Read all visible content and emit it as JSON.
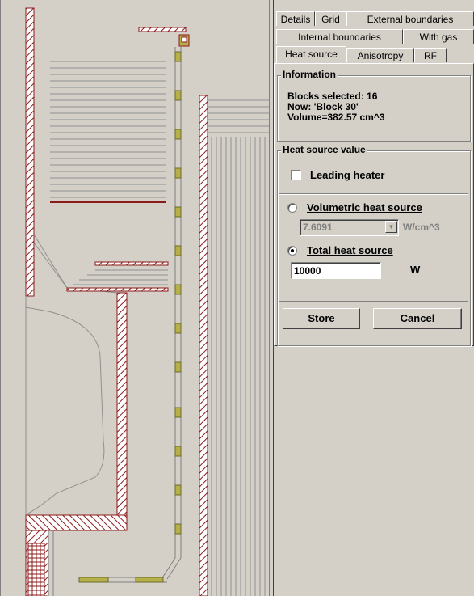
{
  "tabs": {
    "row1": [
      "Details",
      "Grid",
      "External boundaries"
    ],
    "row2": [
      "Internal boundaries",
      "With gas"
    ],
    "row3": [
      "Heat source",
      "Anisotropy",
      "RF"
    ]
  },
  "information": {
    "title": "Information",
    "blocks_selected": "Blocks selected: 16",
    "now": "Now: 'Block 30'",
    "volume": "Volume=382.57 cm^3"
  },
  "heat_source": {
    "title": "Heat source value",
    "leading_heater_label": "Leading heater",
    "leading_heater_checked": false,
    "volumetric_label": "Volumetric heat source",
    "volumetric_value": "7.6091",
    "volumetric_unit": "W/cm^3",
    "total_label": "Total heat source",
    "total_value": "10000",
    "total_unit": "W",
    "selected_option": "total"
  },
  "buttons": {
    "store": "Store",
    "cancel": "Cancel"
  },
  "colors": {
    "wall": "#8b1a1a",
    "heater": "#b5b04a",
    "background": "#d4d0c8"
  }
}
